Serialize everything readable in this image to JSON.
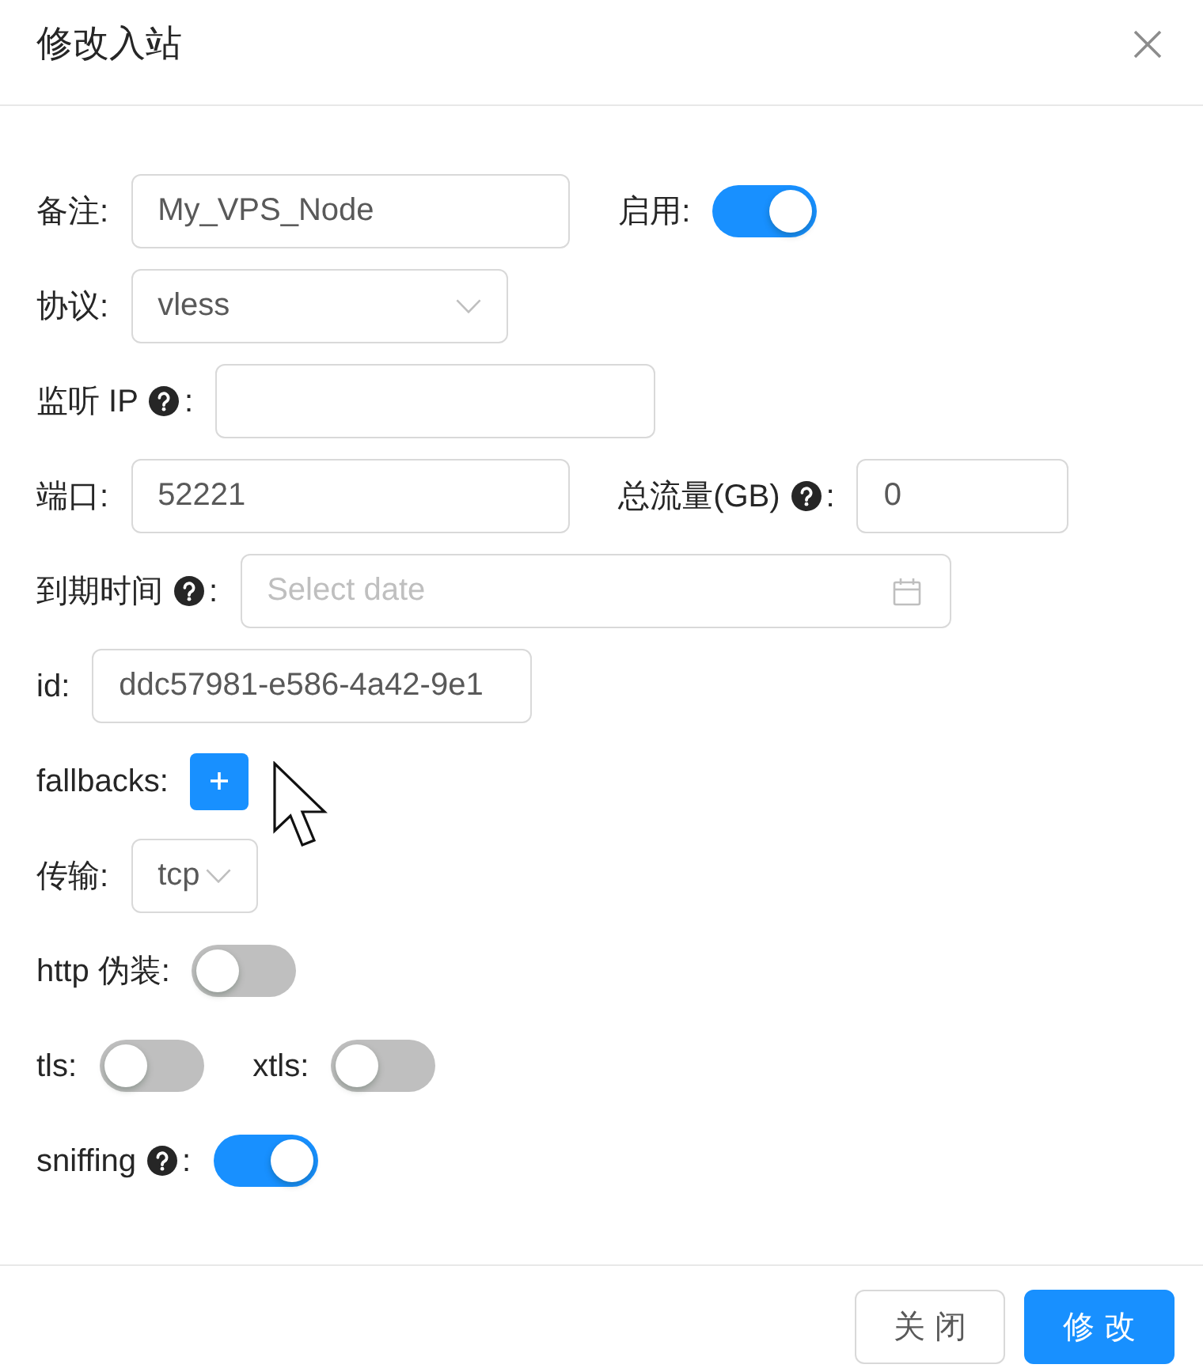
{
  "dialog": {
    "title": "修改入站"
  },
  "form": {
    "rows": [
      {
        "items": [
          {
            "kind": "text",
            "label": "备注:",
            "help": false,
            "value": "My_VPS_Node"
          },
          {
            "kind": "switch",
            "label": "启用:",
            "help": false,
            "on": true
          }
        ]
      },
      {
        "items": [
          {
            "kind": "select",
            "label": "协议:",
            "help": false,
            "value": "vless"
          }
        ]
      },
      {
        "items": [
          {
            "kind": "text",
            "label": "监听 IP",
            "help": true,
            "label_suffix": ":"
          }
        ]
      },
      {
        "items": [
          {
            "kind": "text",
            "label": "端口:",
            "help": false,
            "value": "52221"
          },
          {
            "kind": "text",
            "label": "总流量(GB)",
            "help": true,
            "label_suffix": ":",
            "value": "0"
          }
        ]
      },
      {
        "items": [
          {
            "kind": "date",
            "label": "到期时间",
            "help": true,
            "label_suffix": ":",
            "placeholder": "Select date"
          }
        ]
      },
      {
        "items": [
          {
            "kind": "text",
            "label": "id:",
            "help": false,
            "value": "ddc57981-e586-4a42-9e1"
          }
        ]
      },
      {
        "items": [
          {
            "kind": "add",
            "label": "fallbacks:",
            "help": false
          }
        ]
      },
      {
        "items": [
          {
            "kind": "select",
            "label": "传输:",
            "help": false,
            "value": "tcp"
          }
        ]
      },
      {
        "items": [
          {
            "kind": "switch",
            "label": "http 伪装:",
            "help": false,
            "on": false
          }
        ]
      },
      {
        "items": [
          {
            "kind": "switch",
            "label": "tls:",
            "help": false,
            "on": false
          },
          {
            "kind": "switch",
            "label": "xtls:",
            "help": false,
            "on": false
          }
        ]
      },
      {
        "items": [
          {
            "kind": "switch",
            "label": "sniffing",
            "help": true,
            "label_suffix": ":",
            "on": true
          }
        ]
      }
    ]
  },
  "footer": {
    "buttons": [
      {
        "label": "关闭",
        "kind": "default"
      },
      {
        "label": "修改",
        "kind": "primary"
      }
    ]
  }
}
